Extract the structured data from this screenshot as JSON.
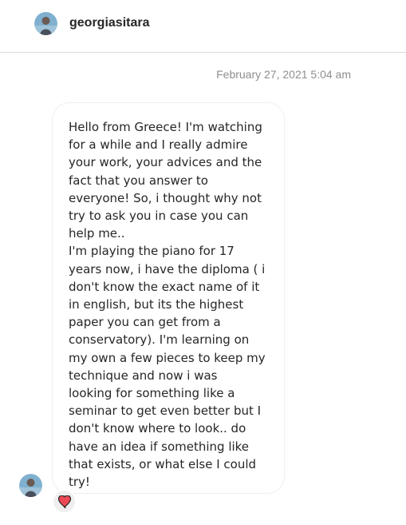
{
  "header": {
    "username": "georgiasitara",
    "avatar_icon": "profile-photo-icon"
  },
  "thread": {
    "timestamp": "February 27, 2021 5:04 am",
    "message": {
      "text": "Hello from Greece! I'm watching\nfor a while and I really admire\nyour work, your advices and the\nfact that you answer to\neveryone! So, i thought why not\ntry to ask you in case you can\nhelp me..\nI'm playing the piano for 17\nyears now, i have the diploma ( i\ndon't know the exact name of it\nin english, but its the highest\npaper you can get from a\nconservatory). I'm learning on\nmy own a few pieces to keep my\ntechnique and now i was\nlooking for something like a\nseminar to get even better but I\ndon't know where to look.. do\nhave an idea if something like\nthat exists, or what else I could\ntry!",
      "reaction_icon": "red-heart-icon"
    }
  },
  "colors": {
    "text": "#262626",
    "secondary_text": "#8e8e8e",
    "border": "#dbdbdb",
    "bubble_border": "#efefef",
    "heart": "#ed4956"
  }
}
